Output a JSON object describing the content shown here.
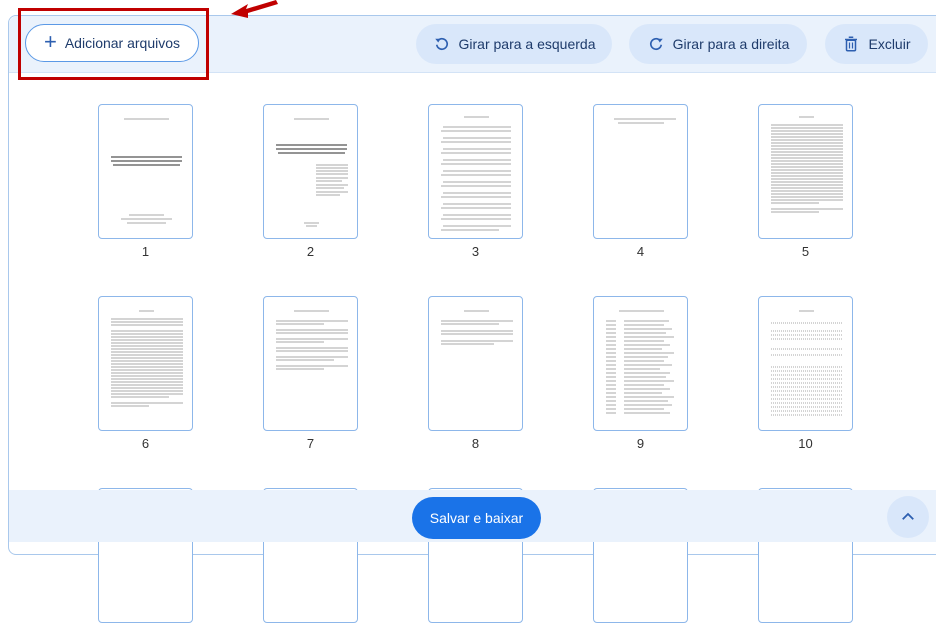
{
  "toolbar": {
    "add_files_label": "Adicionar arquivos",
    "rotate_left_label": "Girar para a esquerda",
    "rotate_right_label": "Girar para a direita",
    "delete_label": "Excluir"
  },
  "pages": [
    {
      "number": "1"
    },
    {
      "number": "2"
    },
    {
      "number": "3"
    },
    {
      "number": "4"
    },
    {
      "number": "5"
    },
    {
      "number": "6"
    },
    {
      "number": "7"
    },
    {
      "number": "8"
    },
    {
      "number": "9"
    },
    {
      "number": "10"
    }
  ],
  "footer": {
    "save_label": "Salvar e baixar"
  },
  "colors": {
    "accent": "#1a73e8",
    "highlight": "#c00000",
    "toolbar_bg": "#eaf2fc"
  },
  "icons": {
    "add": "plus-icon",
    "rotate_left": "rotate-left-icon",
    "rotate_right": "rotate-right-icon",
    "delete": "trash-icon",
    "scroll_up": "chevron-up-icon"
  }
}
